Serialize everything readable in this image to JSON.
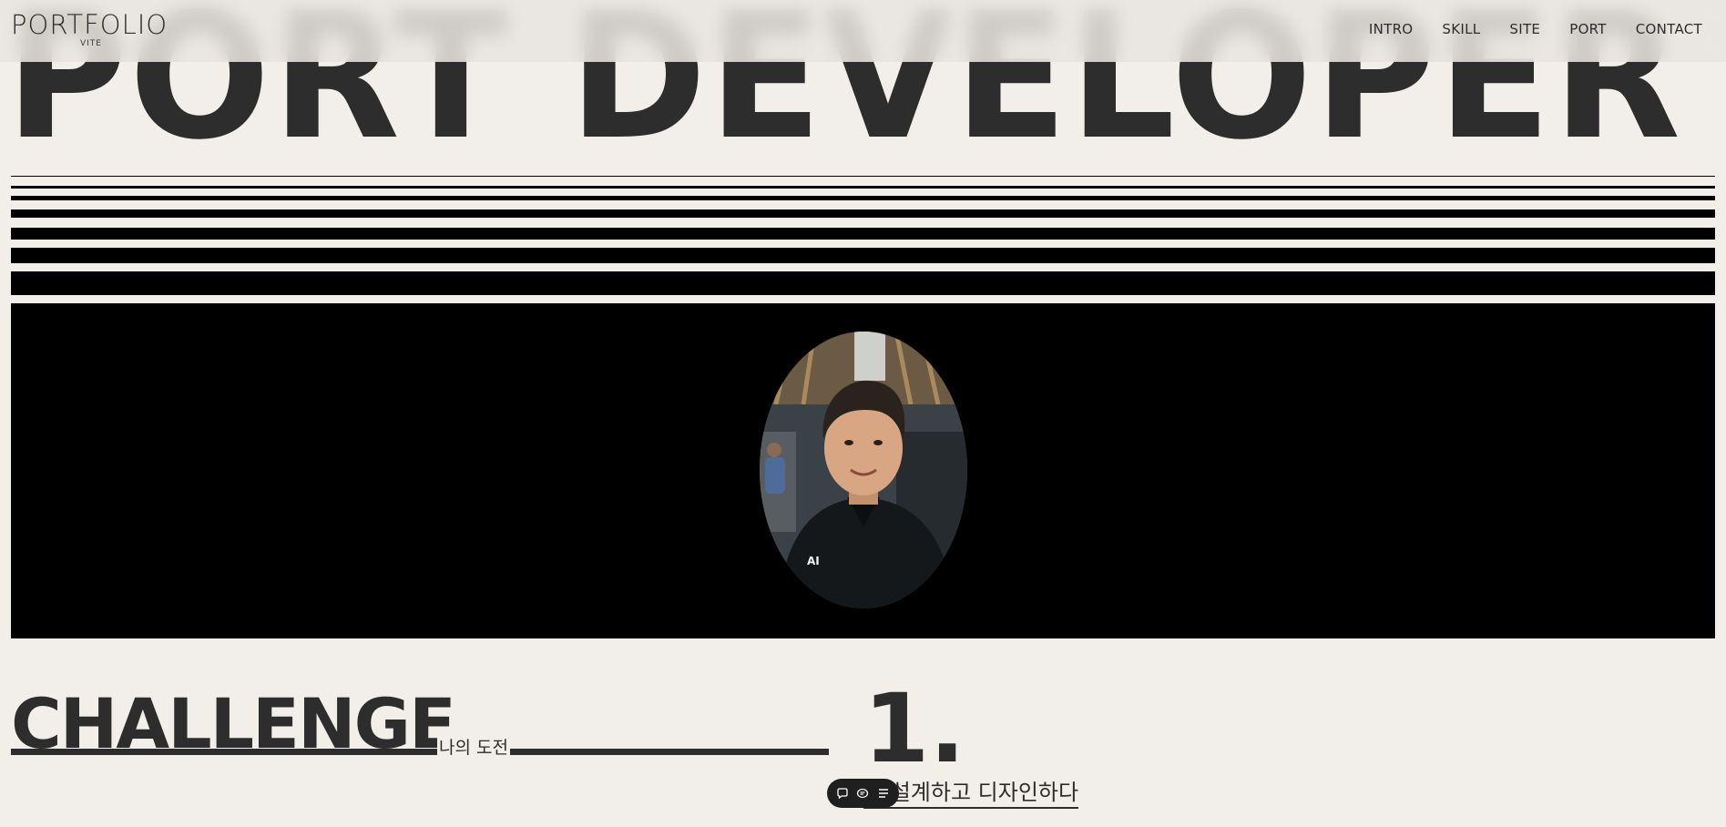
{
  "hero": {
    "title": "PORT DEVELOPER"
  },
  "header": {
    "logo": "PORTFOLIO",
    "logo_sub": "VITE",
    "nav": [
      "INTRO",
      "SKILL",
      "SITE",
      "PORT",
      "CONTACT"
    ]
  },
  "profile": {
    "shirt_logo": "AI"
  },
  "challenge": {
    "title": "CHALLENGE",
    "subtitle": "나의 도전",
    "number": "1.",
    "text": "을 설계하고 디자인하다"
  },
  "toolbar": {
    "icons": [
      "chat-icon",
      "comment-icon",
      "list-icon"
    ]
  },
  "colors": {
    "background": "#f2eeea",
    "text": "#2d2d2d",
    "band": "#000000",
    "toolbar": "#1f1f1f"
  }
}
